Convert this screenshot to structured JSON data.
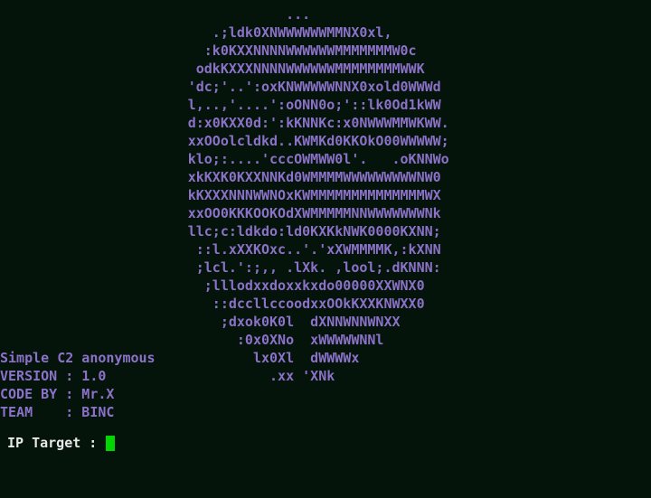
{
  "terminal": {
    "background_color": "#04140a",
    "art_color": "#8b72c8",
    "prompt_color": "#e8e8e8",
    "cursor_color": "#00d700"
  },
  "banner": {
    "name": "skull-ascii-art",
    "lines": [
      "                                   ...",
      "                          .;ldk0XNWWWWWWMMNX0xl,",
      "                         :k0KXXNNNNWWWWWWMMMMMMMW0c",
      "                        odkKXXXNNNNWWWWWWMMMMMMMMWWK",
      "                       'dc;'..':oxKNWWWWWNNX0xold0WWWd",
      "                       l,..,'....':oONN0o;'::lk0Od1kWW",
      "                       d:x0KXX0d:':kKNNKc:x0NWWWMMWKWW.",
      "                       xxOOolcldkd..KWMKd0KKOkO00WWWWW;",
      "                       klo;:....'cccOWMWW0l'.   .oKNNWo",
      "                       xkKXK0KXXNNKd0WMMMMWWWWWWWWWNW0",
      "                       kKXXXNNNWWNOxKWMMMMMMMMMMMMMMWX",
      "                       xxOO0KKKOOKOdXWMMMMMNNWWWWWWWNk",
      "                       llc;c:ldkdo:ld0KXKkNWK0000KXNN;",
      "                        ::l.xXXKOxc..'.'xXWMMMMK,:kXNN",
      "                        ;lcl.':;,, .lXk. ,lool;.dKNNN:",
      "                         ;lllodxxdoxxkxdo00000XXWNX0",
      "                          ::dccllccoodxxOOkKXXKNWXX0",
      "                           ;dxok0K0l  dXNNWNNWNXX",
      "                             :0x0XNo  xWWWWWNNl",
      "                               lx0Xl  dWWWWx",
      "                                 .xx 'XNk"
    ]
  },
  "info": {
    "name": "program-info",
    "title": "Simple C2 anonymous",
    "lines": [
      "Simple C2 anonymous",
      "VERSION : 1.0",
      "CODE BY : Mr.X",
      "TEAM    : BINC"
    ],
    "fields": {
      "version_label": "VERSION",
      "version_value": "1.0",
      "code_by_label": "CODE BY",
      "code_by_value": "Mr.X",
      "team_label": "TEAM",
      "team_value": "BINC",
      "separator": ":"
    }
  },
  "prompt": {
    "name": "ip-target-prompt",
    "label": "IP Target : ",
    "value": "",
    "placeholder": ""
  }
}
